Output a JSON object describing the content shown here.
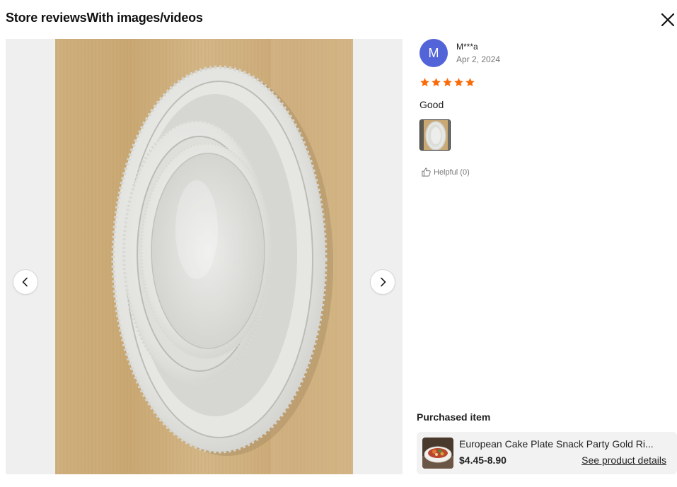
{
  "header": {
    "title": "Store reviewsWith images/videos",
    "close_icon": "close-icon"
  },
  "gallery": {
    "prev_icon": "chevron-left-icon",
    "next_icon": "chevron-right-icon",
    "photo_subject": "stacked white oval ceramic plates on wooden surface"
  },
  "review": {
    "avatar_initial": "M",
    "avatar_color": "#5363d8",
    "reviewer_name": "M***a",
    "date": "Apr 2, 2024",
    "rating": 5,
    "rating_max": 5,
    "star_color": "#fb6a08",
    "text": "Good",
    "helpful_icon": "thumbs-up-icon",
    "helpful_label": "Helpful (0)"
  },
  "purchased": {
    "heading": "Purchased item",
    "product_title": "European Cake Plate Snack Party Gold Ri...",
    "price": "$4.45-8.90",
    "details_link": "See product details"
  }
}
